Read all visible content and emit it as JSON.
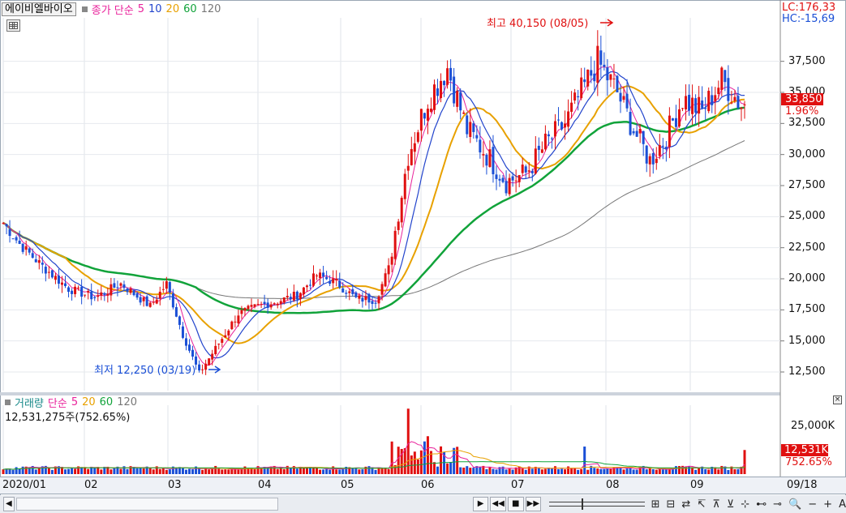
{
  "legend": {
    "stock_name": "에이비엘바이오",
    "price_label": "종가 단순",
    "ma": [
      "5",
      "10",
      "20",
      "60",
      "120"
    ]
  },
  "colors": {
    "ma5": "#e9229b",
    "ma10": "#2244cc",
    "ma20": "#e8a100",
    "ma60": "#11a33a",
    "ma120": "#777777",
    "up": "#e01010",
    "down": "#1a4fd6",
    "lc": "#e01010",
    "hc": "#1a4fd6",
    "current": "#e01010"
  },
  "axis_info": {
    "lc": "LC:176,33",
    "hc": "HC:-15,69",
    "current_price": "33,850",
    "current_pct": "1.96%",
    "price_ticks": [
      "37,500",
      "35,000",
      "32,500",
      "30,000",
      "27,500",
      "25,000",
      "22,500",
      "20,000",
      "17,500",
      "15,000",
      "12,500"
    ],
    "volume_ticks": [
      "25,000K"
    ],
    "current_volume": "12,531K",
    "current_volume_pct": "752.65%"
  },
  "annotations": {
    "high": "최고 40,150 (08/05)",
    "low": "최저 12,250 (03/19)"
  },
  "volume": {
    "legend_label": "거래량",
    "ma_label": "단순",
    "ma": [
      "5",
      "20",
      "60",
      "120"
    ],
    "value_text": "12,531,275주(752.65%)"
  },
  "xaxis": {
    "labels": [
      "2020/01",
      "02",
      "03",
      "04",
      "05",
      "06",
      "07",
      "08",
      "09"
    ],
    "end_label": "09/18"
  },
  "toolbar": {
    "buttons": [
      "▶",
      "◀◀",
      "■",
      "▶▶"
    ],
    "icons": [
      "⊞",
      "⊟",
      "⇄",
      "↸",
      "⊼",
      "⊻",
      "⊹",
      "⊷",
      "⊸",
      "🔍",
      "−",
      "+",
      "A"
    ]
  },
  "chart_data": {
    "type": "candlestick",
    "price_range": [
      11000,
      41000
    ],
    "months": [
      "2020/01",
      "02",
      "03",
      "04",
      "05",
      "06",
      "07",
      "08",
      "09"
    ],
    "price_keyframes": [
      [
        0,
        24500
      ],
      [
        5,
        22800
      ],
      [
        12,
        21000
      ],
      [
        20,
        19200
      ],
      [
        28,
        18500
      ],
      [
        36,
        19600
      ],
      [
        45,
        17800
      ],
      [
        50,
        19600
      ],
      [
        55,
        15500
      ],
      [
        60,
        12400
      ],
      [
        66,
        14800
      ],
      [
        72,
        17200
      ],
      [
        78,
        17800
      ],
      [
        84,
        18200
      ],
      [
        90,
        18700
      ],
      [
        96,
        20300
      ],
      [
        102,
        19700
      ],
      [
        108,
        18400
      ],
      [
        114,
        18300
      ],
      [
        118,
        20800
      ],
      [
        124,
        30000
      ],
      [
        130,
        34500
      ],
      [
        136,
        37000
      ],
      [
        142,
        32000
      ],
      [
        148,
        30000
      ],
      [
        154,
        27800
      ],
      [
        160,
        28500
      ],
      [
        166,
        30800
      ],
      [
        172,
        32500
      ],
      [
        178,
        35500
      ],
      [
        182,
        37500
      ],
      [
        188,
        35000
      ],
      [
        193,
        32000
      ],
      [
        198,
        29500
      ],
      [
        203,
        31500
      ],
      [
        208,
        34500
      ],
      [
        214,
        33500
      ],
      [
        220,
        36000
      ],
      [
        226,
        34000
      ]
    ]
  }
}
